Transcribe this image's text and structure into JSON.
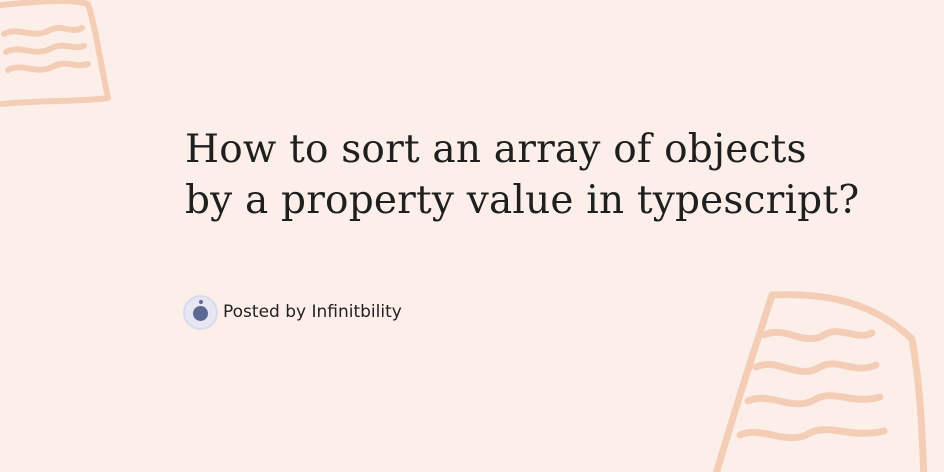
{
  "title": {
    "line1": "How to sort an array of objects",
    "line2": "by a property value in typescript?"
  },
  "author": {
    "prefix": "Posted by",
    "name": "Infinitbility"
  },
  "colors": {
    "background": "#fcefea",
    "doodle": "#f3c8ad",
    "avatar_fill": "#5c6a93",
    "avatar_ring": "#e6e7f3",
    "text": "#1f1f1f"
  },
  "icons": {
    "avatar": "avatar-icon",
    "decoration": "paper-sketch-icon"
  }
}
